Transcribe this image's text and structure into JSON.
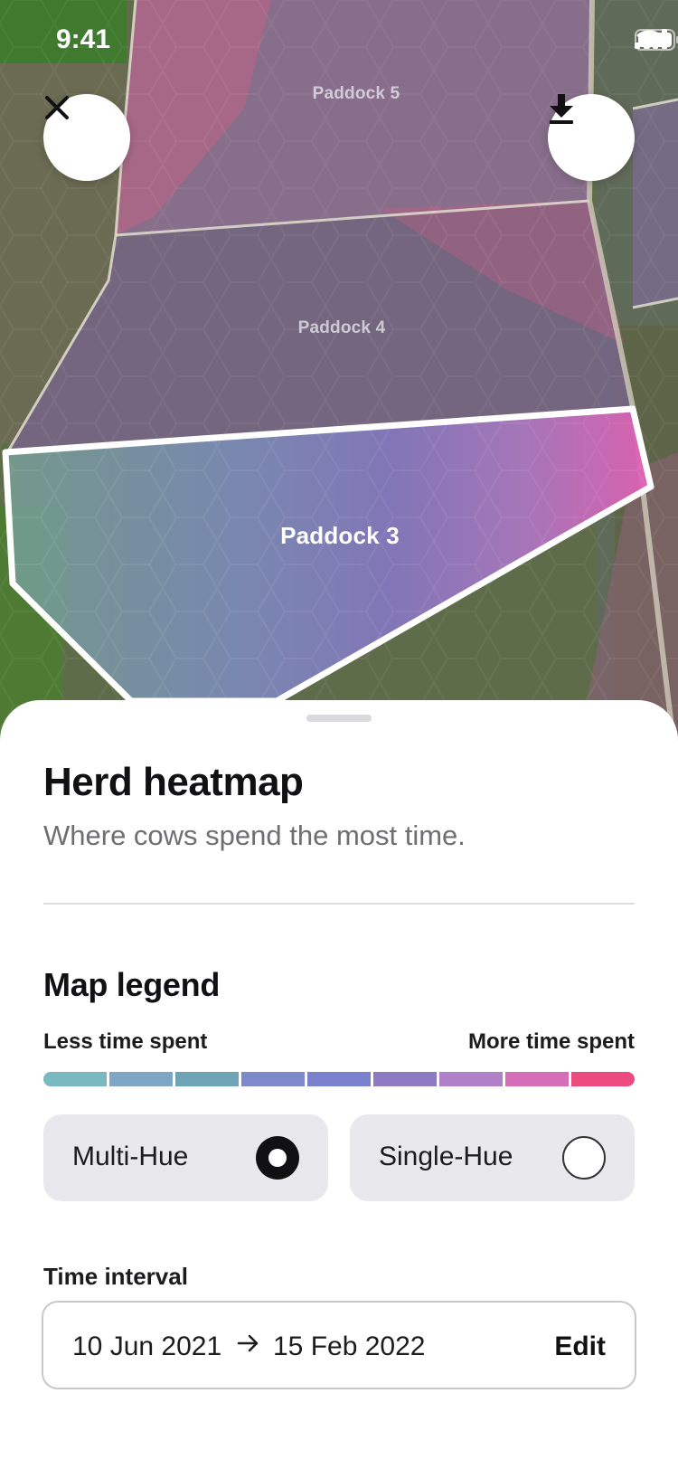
{
  "status_bar": {
    "time": "9:41",
    "icons": [
      "cellular-signal-icon",
      "wifi-icon",
      "battery-icon"
    ]
  },
  "map": {
    "paddocks": [
      {
        "label": "Paddock 5",
        "selected": false
      },
      {
        "label": "Paddock 4",
        "selected": false
      },
      {
        "label": "Paddock 3",
        "selected": true
      }
    ],
    "buttons": {
      "close_icon": "close-icon",
      "download_icon": "download-icon"
    }
  },
  "sheet": {
    "title": "Herd heatmap",
    "subtitle": "Where cows spend the most time.",
    "legend": {
      "title": "Map legend",
      "less_label": "Less time spent",
      "more_label": "More time spent",
      "colors": [
        "#7ab9c0",
        "#7fa6c4",
        "#6fa3b6",
        "#7d89cb",
        "#7b80cc",
        "#8c7bc3",
        "#b081c8",
        "#d66db8",
        "#ec4b7d"
      ]
    },
    "hue_options": [
      {
        "label": "Multi-Hue",
        "selected": true
      },
      {
        "label": "Single-Hue",
        "selected": false
      }
    ],
    "time_interval": {
      "label": "Time interval",
      "start": "10 Jun 2021",
      "end": "15 Feb 2022",
      "edit_label": "Edit"
    }
  }
}
